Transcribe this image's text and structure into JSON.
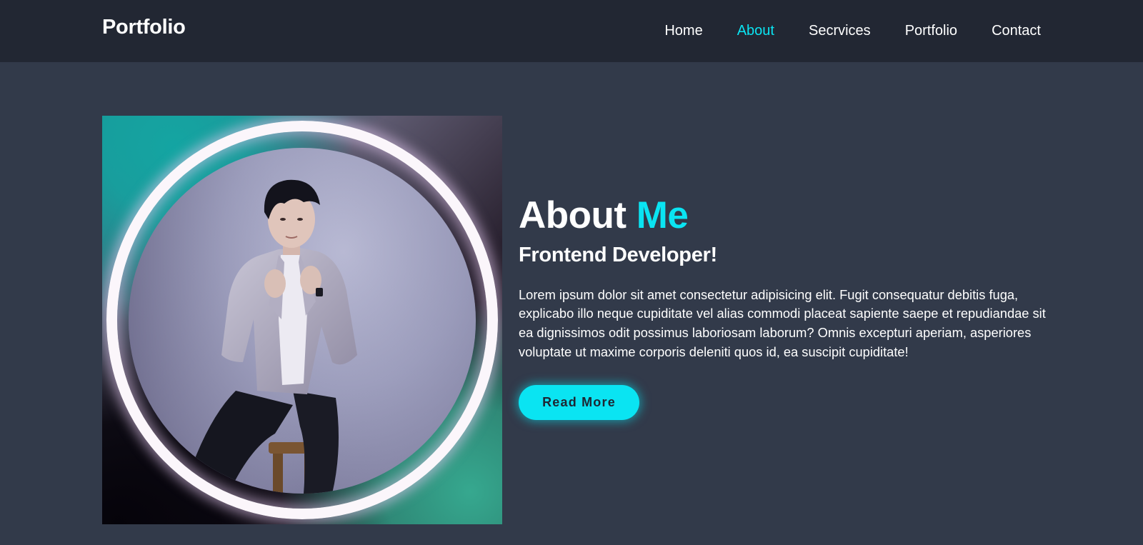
{
  "header": {
    "logo": "Portfolio",
    "nav": [
      {
        "label": "Home",
        "active": false
      },
      {
        "label": "About",
        "active": true
      },
      {
        "label": "Secrvices",
        "active": false
      },
      {
        "label": "Portfolio",
        "active": false
      },
      {
        "label": "Contact",
        "active": false
      }
    ]
  },
  "about": {
    "heading_main": "About ",
    "heading_accent": "Me",
    "subheading": "Frontend Developer!",
    "description": "Lorem ipsum dolor sit amet consectetur adipisicing elit. Fugit consequatur debitis fuga, explicabo illo neque cupiditate vel alias commodi placeat sapiente saepe et repudiandae sit ea dignissimos odit possimus laboriosam laborum? Omnis excepturi aperiam, asperiores voluptate ut maxime corporis deleniti quos id, ea suscipit cupiditate!",
    "button_label": "Read More"
  },
  "colors": {
    "accent": "#0ae4f2",
    "navbar_bg": "#222733",
    "page_bg": "#323a4a",
    "button_text": "#1e2632"
  }
}
